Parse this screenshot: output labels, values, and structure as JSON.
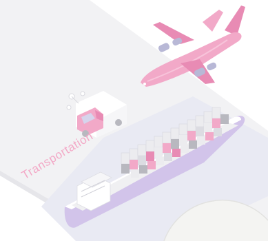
{
  "scene": {
    "caption": "Transportation",
    "colors": {
      "ground": "#f2f2f4",
      "water": "#e9eaf3",
      "accent_pink": "#f2a9c8",
      "deep_pink": "#e88bb4",
      "hull_purple": "#c8b6e2",
      "caption_pink": "#f3a8c6",
      "gray": "#b8b8bf",
      "white": "#ffffff"
    },
    "icons": [
      "airplane-icon",
      "delivery-van-icon",
      "cargo-ship-icon"
    ]
  }
}
